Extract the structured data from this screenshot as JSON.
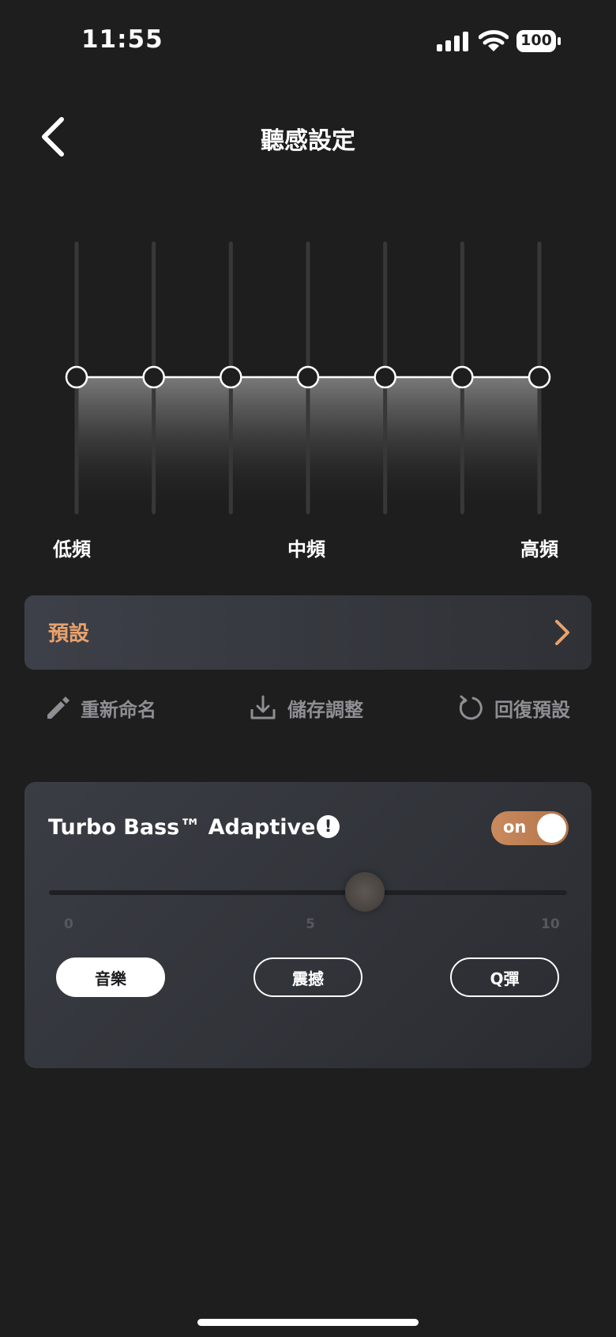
{
  "status_bar": {
    "time": "11:55",
    "battery": "100"
  },
  "header": {
    "title": "聽感設定"
  },
  "equalizer": {
    "band_labels": {
      "low": "低頻",
      "mid": "中頻",
      "high": "高頻"
    },
    "band_count": 7,
    "gains": [
      0,
      0,
      0,
      0,
      0,
      0,
      0
    ]
  },
  "preset": {
    "label": "預設"
  },
  "actions": {
    "rename": "重新命名",
    "save": "儲存調整",
    "reset": "回復預設"
  },
  "turbo_bass": {
    "title": "Turbo Bass™ Adaptive",
    "info_symbol": "!",
    "toggle_label": "on",
    "toggle_on": true,
    "slider": {
      "min_label": "0",
      "mid_label": "5",
      "max_label": "10",
      "value": 6
    },
    "modes": [
      "音樂",
      "震撼",
      "Q彈"
    ],
    "selected_mode": "音樂"
  },
  "colors": {
    "accent": "#e8a26d",
    "toggle": "#c4865a",
    "background": "#1e1e1e"
  }
}
